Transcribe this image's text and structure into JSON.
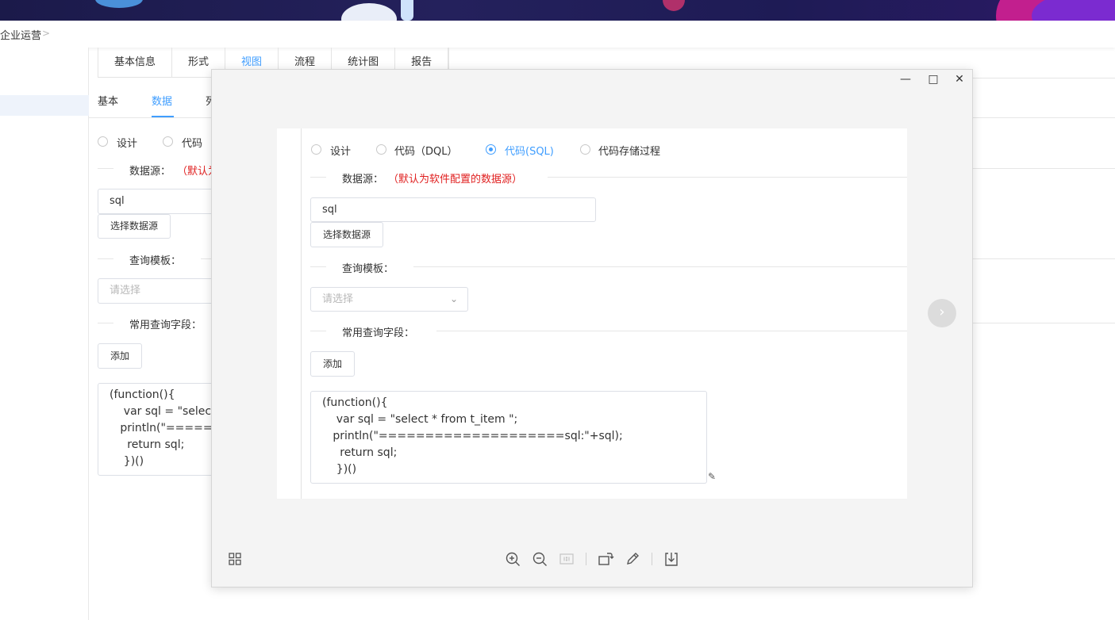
{
  "breadcrumb": {
    "current": "企业运营"
  },
  "tabs": [
    "基本信息",
    "形式",
    "视图",
    "流程",
    "统计图",
    "报告"
  ],
  "active_tab_index": 2,
  "subtabs": [
    "基本",
    "数据",
    "列"
  ],
  "active_subtab_index": 1,
  "background_form": {
    "mode_options": [
      "设计",
      "代码"
    ],
    "datasource_label": "数据源：",
    "datasource_note": "（默认为",
    "datasource_value": "sql",
    "choose_datasource_button": "选择数据源",
    "query_template_label": "查询模板：",
    "query_template_placeholder": "请选择",
    "common_fields_label": "常用查询字段：",
    "add_button": "添加",
    "code_lines": [
      "(function(){",
      "    var sql = \"select",
      "   println(\"=======",
      "     return sql;",
      "    })()"
    ]
  },
  "modal": {
    "mode_options": [
      {
        "label": "设计",
        "checked": false
      },
      {
        "label": "代码（DQL）",
        "checked": false
      },
      {
        "label": "代码(SQL)",
        "checked": true
      },
      {
        "label": "代码存储过程",
        "checked": false
      }
    ],
    "datasource_label": "数据源：",
    "datasource_note": "（默认为软件配置的数据源）",
    "datasource_value": "sql",
    "choose_datasource_button": "选择数据源",
    "query_template_label": "查询模板：",
    "query_template_placeholder": "请选择",
    "common_fields_label": "常用查询字段：",
    "add_button": "添加",
    "code": "(function(){\n    var sql = \"select * from t_item \";\n   println(\"====================sql:\"+sql);\n     return sql;\n    })()",
    "toolbar_icons": [
      "grid-icon",
      "zoom-in-icon",
      "zoom-out-icon",
      "actual-size-icon",
      "rotate-icon",
      "edit-icon",
      "download-icon"
    ]
  },
  "colors": {
    "accent": "#409eff",
    "note_red": "#e02020"
  }
}
